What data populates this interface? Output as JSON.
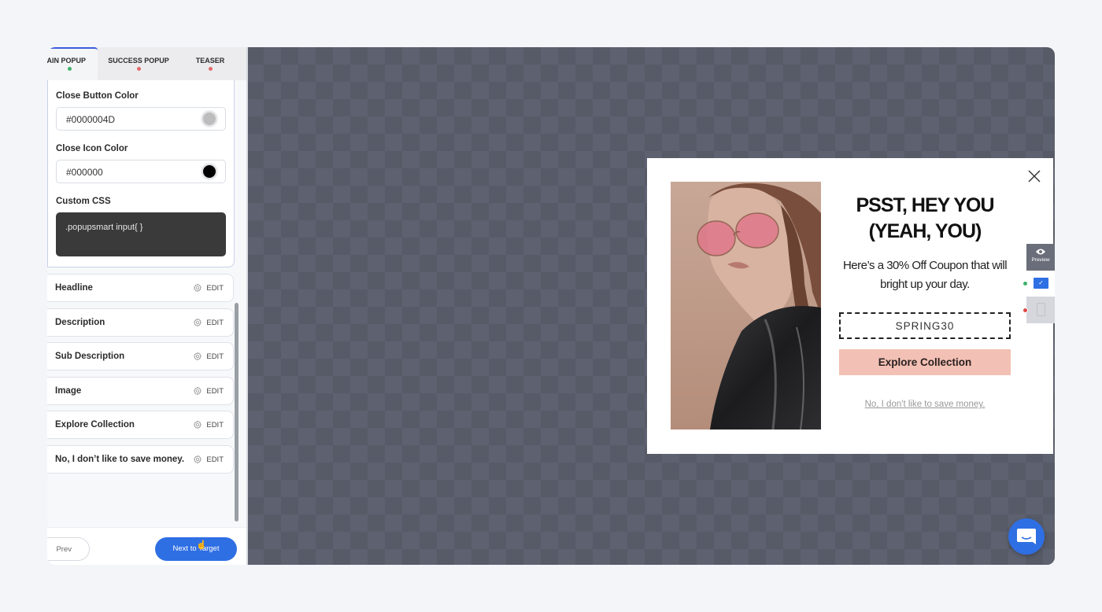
{
  "tabs": [
    {
      "label": "MAIN POPUP",
      "status_color": "#3fb26b",
      "active": true
    },
    {
      "label": "SUCCESS POPUP",
      "status_color": "#e36a6a",
      "active": false
    },
    {
      "label": "TEASER",
      "status_color": "#e36a6a",
      "active": false
    }
  ],
  "settings": {
    "close_button_color_label": "Close Button Color",
    "close_button_color_value": "#0000004D",
    "close_button_swatch": "#bdbdbd",
    "close_icon_color_label": "Close Icon Color",
    "close_icon_color_value": "#000000",
    "close_icon_swatch": "#000000",
    "custom_css_label": "Custom CSS",
    "custom_css_value": ".popupsmart input{ }"
  },
  "elements": [
    {
      "name": "Headline",
      "action": "EDIT"
    },
    {
      "name": "Description",
      "action": "EDIT"
    },
    {
      "name": "Sub Description",
      "action": "EDIT"
    },
    {
      "name": "Image",
      "action": "EDIT"
    },
    {
      "name": "Explore Collection",
      "action": "EDIT"
    },
    {
      "name": "No, I don’t like to save money.",
      "action": "EDIT"
    }
  ],
  "footer": {
    "prev_label": "Prev",
    "next_label": "Next to Target"
  },
  "popup": {
    "headline_line1": "PSST, HEY YOU",
    "headline_line2": "(YEAH, YOU)",
    "description_line1": "Here’s a 30% Off Coupon that will",
    "description_line2": "bright up your day.",
    "coupon_code": "SPRING30",
    "cta_label": "Explore Collection",
    "cta_color": "#f2c0b4",
    "decline_label": "No, I don't like to save money.",
    "image_alt": "Woman wearing pink-tinted round sunglasses and black vinyl jacket"
  },
  "device_toggle": {
    "preview_label": "Preview",
    "desktop_status": "#3fb26b",
    "mobile_status": "#e04848"
  },
  "colors": {
    "accent": "#2f6fe4"
  }
}
